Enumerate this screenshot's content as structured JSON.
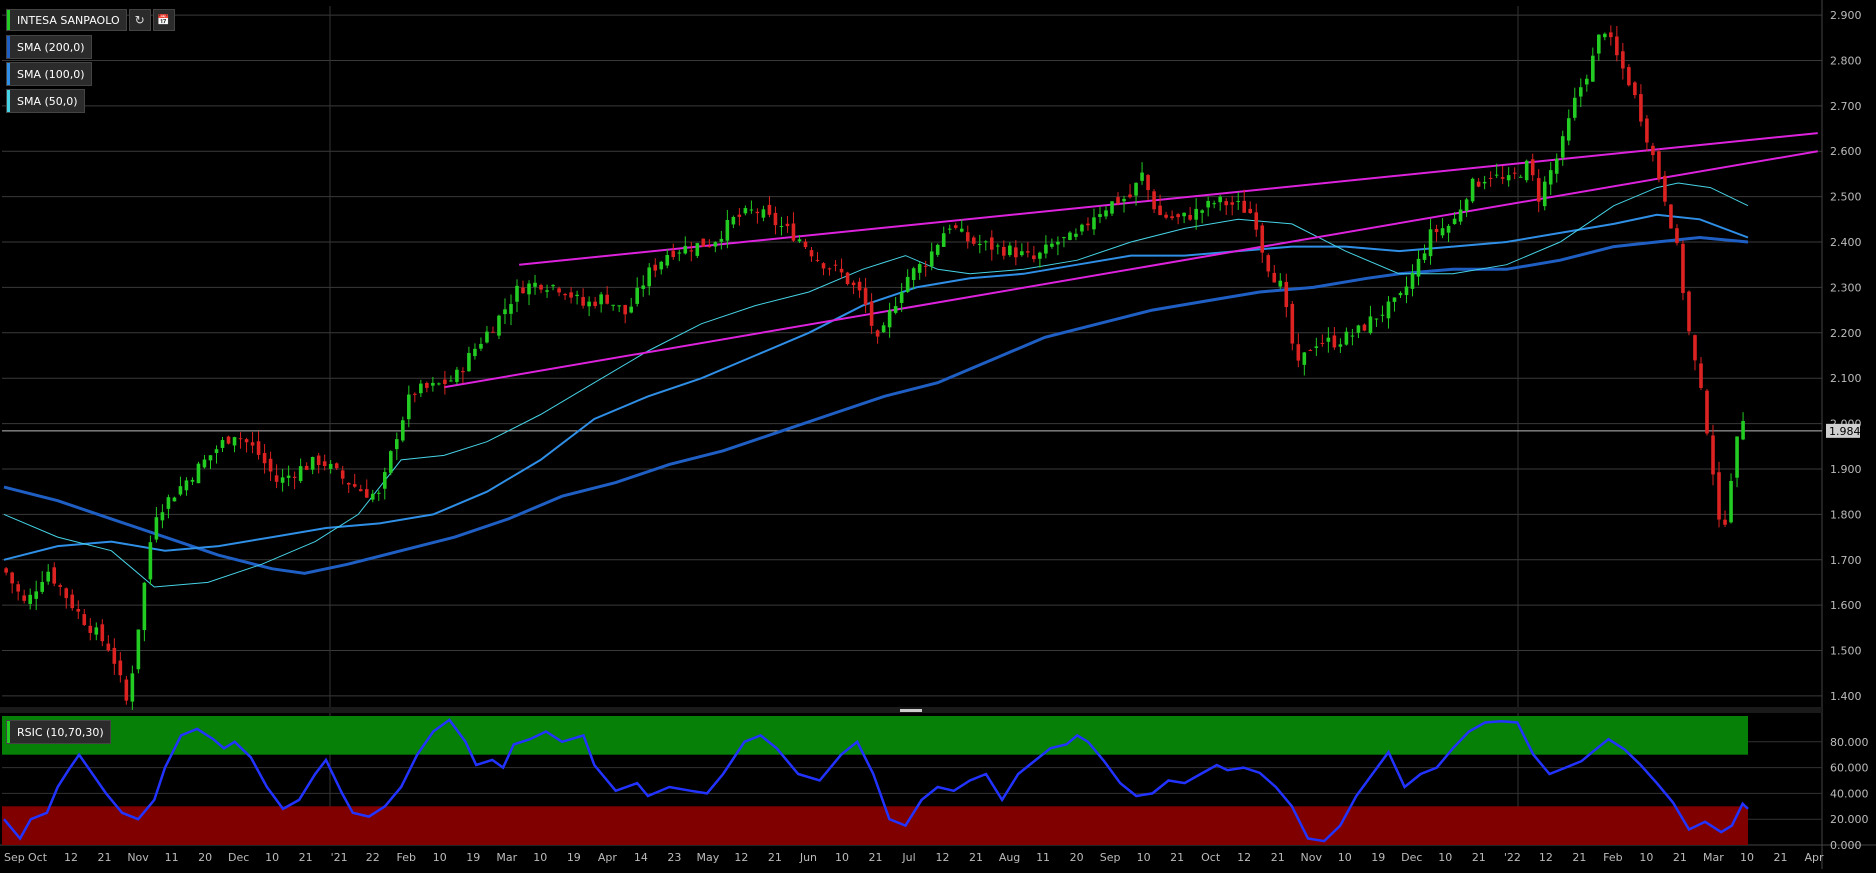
{
  "instrument": {
    "name": "INTESA SANPAOLO",
    "last_price_label": "1.984",
    "refresh_icon": "refresh-icon",
    "calendar_icon": "calendar-icon"
  },
  "indicators": [
    {
      "label": "SMA (200,0)",
      "color": "#1f5fc4"
    },
    {
      "label": "SMA (100,0)",
      "color": "#2f8fe6"
    },
    {
      "label": "SMA (50,0)",
      "color": "#46d3e6"
    }
  ],
  "rsi_panel": {
    "label": "RSIC (10,70,30)",
    "color": "#2233ff"
  },
  "colors": {
    "up": "#22cc22",
    "down": "#dd2222",
    "trendline": "#dd22dd",
    "overbought_zone": "#078007",
    "oversold_zone": "#800000"
  },
  "chart_data": [
    {
      "type": "candlestick",
      "y_ticks": [
        "2.900",
        "2.800",
        "2.700",
        "2.600",
        "2.500",
        "2.400",
        "2.300",
        "2.200",
        "2.100",
        "2.000",
        "1.900",
        "1.800",
        "1.700",
        "1.600",
        "1.500",
        "1.400"
      ],
      "ylim": [
        1.38,
        2.92
      ],
      "x_ticks": [
        "Sep",
        "Oct",
        "12",
        "21",
        "Nov",
        "11",
        "20",
        "Dec",
        "10",
        "21",
        "'21",
        "22",
        "Feb",
        "10",
        "19",
        "Mar",
        "10",
        "19",
        "Apr",
        "14",
        "23",
        "May",
        "12",
        "21",
        "Jun",
        "10",
        "21",
        "Jul",
        "12",
        "21",
        "Aug",
        "11",
        "20",
        "Sep",
        "10",
        "21",
        "Oct",
        "12",
        "21",
        "Nov",
        "10",
        "19",
        "Dec",
        "10",
        "21",
        "'22",
        "12",
        "21",
        "Feb",
        "10",
        "21",
        "Mar",
        "10",
        "21",
        "Apr"
      ],
      "last_price": 1.984,
      "close_path": [
        [
          0,
          1.68
        ],
        [
          20,
          1.6
        ],
        [
          40,
          1.68
        ],
        [
          70,
          1.58
        ],
        [
          100,
          1.5
        ],
        [
          115,
          1.38
        ],
        [
          125,
          1.55
        ],
        [
          140,
          1.8
        ],
        [
          160,
          1.85
        ],
        [
          180,
          1.9
        ],
        [
          200,
          1.95
        ],
        [
          215,
          1.98
        ],
        [
          235,
          1.94
        ],
        [
          255,
          1.87
        ],
        [
          275,
          1.9
        ],
        [
          295,
          1.92
        ],
        [
          315,
          1.88
        ],
        [
          335,
          1.85
        ],
        [
          350,
          1.84
        ],
        [
          365,
          1.97
        ],
        [
          380,
          2.07
        ],
        [
          400,
          2.08
        ],
        [
          420,
          2.1
        ],
        [
          440,
          2.17
        ],
        [
          460,
          2.23
        ],
        [
          480,
          2.3
        ],
        [
          500,
          2.31
        ],
        [
          520,
          2.3
        ],
        [
          540,
          2.26
        ],
        [
          560,
          2.28
        ],
        [
          580,
          2.24
        ],
        [
          600,
          2.33
        ],
        [
          620,
          2.38
        ],
        [
          640,
          2.39
        ],
        [
          660,
          2.4
        ],
        [
          680,
          2.45
        ],
        [
          700,
          2.47
        ],
        [
          720,
          2.44
        ],
        [
          740,
          2.41
        ],
        [
          760,
          2.36
        ],
        [
          780,
          2.33
        ],
        [
          800,
          2.28
        ],
        [
          815,
          2.17
        ],
        [
          825,
          2.24
        ],
        [
          840,
          2.32
        ],
        [
          860,
          2.36
        ],
        [
          880,
          2.44
        ],
        [
          900,
          2.4
        ],
        [
          920,
          2.39
        ],
        [
          940,
          2.38
        ],
        [
          960,
          2.36
        ],
        [
          980,
          2.4
        ],
        [
          1000,
          2.41
        ],
        [
          1015,
          2.46
        ],
        [
          1035,
          2.49
        ],
        [
          1050,
          2.5
        ],
        [
          1060,
          2.55
        ],
        [
          1075,
          2.46
        ],
        [
          1095,
          2.45
        ],
        [
          1115,
          2.47
        ],
        [
          1130,
          2.49
        ],
        [
          1150,
          2.48
        ],
        [
          1165,
          2.46
        ],
        [
          1175,
          2.36
        ],
        [
          1190,
          2.3
        ],
        [
          1205,
          2.12
        ],
        [
          1220,
          2.18
        ],
        [
          1240,
          2.18
        ],
        [
          1260,
          2.2
        ],
        [
          1280,
          2.24
        ],
        [
          1300,
          2.27
        ],
        [
          1315,
          2.34
        ],
        [
          1330,
          2.42
        ],
        [
          1350,
          2.44
        ],
        [
          1365,
          2.52
        ],
        [
          1385,
          2.55
        ],
        [
          1400,
          2.53
        ],
        [
          1420,
          2.57
        ],
        [
          1430,
          2.5
        ],
        [
          1450,
          2.6
        ],
        [
          1465,
          2.72
        ],
        [
          1480,
          2.8
        ],
        [
          1490,
          2.88
        ],
        [
          1500,
          2.82
        ],
        [
          1515,
          2.75
        ],
        [
          1525,
          2.68
        ],
        [
          1535,
          2.6
        ],
        [
          1550,
          2.48
        ],
        [
          1560,
          2.37
        ],
        [
          1570,
          2.2
        ],
        [
          1580,
          2.08
        ],
        [
          1590,
          1.95
        ],
        [
          1600,
          1.73
        ],
        [
          1610,
          1.9
        ],
        [
          1620,
          2.02
        ],
        [
          1625,
          1.96
        ]
      ],
      "sma50": [
        [
          0,
          1.8
        ],
        [
          50,
          1.75
        ],
        [
          100,
          1.72
        ],
        [
          140,
          1.64
        ],
        [
          190,
          1.65
        ],
        [
          240,
          1.69
        ],
        [
          290,
          1.74
        ],
        [
          330,
          1.8
        ],
        [
          370,
          1.92
        ],
        [
          410,
          1.93
        ],
        [
          450,
          1.96
        ],
        [
          500,
          2.02
        ],
        [
          550,
          2.09
        ],
        [
          600,
          2.16
        ],
        [
          650,
          2.22
        ],
        [
          700,
          2.26
        ],
        [
          750,
          2.29
        ],
        [
          800,
          2.34
        ],
        [
          840,
          2.37
        ],
        [
          870,
          2.34
        ],
        [
          900,
          2.33
        ],
        [
          950,
          2.34
        ],
        [
          1000,
          2.36
        ],
        [
          1050,
          2.4
        ],
        [
          1100,
          2.43
        ],
        [
          1150,
          2.45
        ],
        [
          1200,
          2.44
        ],
        [
          1250,
          2.38
        ],
        [
          1300,
          2.33
        ],
        [
          1350,
          2.33
        ],
        [
          1400,
          2.35
        ],
        [
          1450,
          2.4
        ],
        [
          1500,
          2.48
        ],
        [
          1540,
          2.52
        ],
        [
          1560,
          2.53
        ],
        [
          1590,
          2.52
        ],
        [
          1625,
          2.48
        ]
      ],
      "sma100": [
        [
          0,
          1.7
        ],
        [
          50,
          1.73
        ],
        [
          100,
          1.74
        ],
        [
          150,
          1.72
        ],
        [
          200,
          1.73
        ],
        [
          250,
          1.75
        ],
        [
          300,
          1.77
        ],
        [
          350,
          1.78
        ],
        [
          400,
          1.8
        ],
        [
          450,
          1.85
        ],
        [
          500,
          1.92
        ],
        [
          550,
          2.01
        ],
        [
          600,
          2.06
        ],
        [
          650,
          2.1
        ],
        [
          700,
          2.15
        ],
        [
          750,
          2.2
        ],
        [
          800,
          2.26
        ],
        [
          850,
          2.3
        ],
        [
          900,
          2.32
        ],
        [
          950,
          2.33
        ],
        [
          1000,
          2.35
        ],
        [
          1050,
          2.37
        ],
        [
          1100,
          2.37
        ],
        [
          1150,
          2.38
        ],
        [
          1200,
          2.39
        ],
        [
          1250,
          2.39
        ],
        [
          1300,
          2.38
        ],
        [
          1350,
          2.39
        ],
        [
          1400,
          2.4
        ],
        [
          1450,
          2.42
        ],
        [
          1500,
          2.44
        ],
        [
          1540,
          2.46
        ],
        [
          1580,
          2.45
        ],
        [
          1625,
          2.41
        ]
      ],
      "sma200": [
        [
          0,
          1.86
        ],
        [
          50,
          1.83
        ],
        [
          100,
          1.79
        ],
        [
          150,
          1.75
        ],
        [
          200,
          1.71
        ],
        [
          250,
          1.68
        ],
        [
          280,
          1.67
        ],
        [
          320,
          1.69
        ],
        [
          370,
          1.72
        ],
        [
          420,
          1.75
        ],
        [
          470,
          1.79
        ],
        [
          520,
          1.84
        ],
        [
          570,
          1.87
        ],
        [
          620,
          1.91
        ],
        [
          670,
          1.94
        ],
        [
          720,
          1.98
        ],
        [
          770,
          2.02
        ],
        [
          820,
          2.06
        ],
        [
          870,
          2.09
        ],
        [
          920,
          2.14
        ],
        [
          970,
          2.19
        ],
        [
          1020,
          2.22
        ],
        [
          1070,
          2.25
        ],
        [
          1120,
          2.27
        ],
        [
          1170,
          2.29
        ],
        [
          1220,
          2.3
        ],
        [
          1270,
          2.32
        ],
        [
          1300,
          2.33
        ],
        [
          1350,
          2.34
        ],
        [
          1400,
          2.34
        ],
        [
          1450,
          2.36
        ],
        [
          1500,
          2.39
        ],
        [
          1540,
          2.4
        ],
        [
          1580,
          2.41
        ],
        [
          1625,
          2.4
        ]
      ],
      "trendlines": [
        {
          "from": [
            480,
            2.35
          ],
          "to": [
            1690,
            2.64
          ]
        },
        {
          "from": [
            410,
            2.08
          ],
          "to": [
            1690,
            2.6
          ]
        }
      ]
    },
    {
      "type": "line",
      "title": "RSIC (10,70,30)",
      "y_ticks": [
        "80.000",
        "60.000",
        "40.000",
        "20.000",
        "0.000"
      ],
      "ylim": [
        0,
        100
      ],
      "zones": {
        "overbought": [
          70,
          100
        ],
        "oversold": [
          0,
          30
        ]
      },
      "values": [
        [
          0,
          20
        ],
        [
          15,
          5
        ],
        [
          25,
          20
        ],
        [
          40,
          25
        ],
        [
          50,
          45
        ],
        [
          60,
          58
        ],
        [
          70,
          70
        ],
        [
          80,
          58
        ],
        [
          95,
          40
        ],
        [
          110,
          25
        ],
        [
          125,
          20
        ],
        [
          140,
          35
        ],
        [
          150,
          60
        ],
        [
          165,
          85
        ],
        [
          180,
          90
        ],
        [
          195,
          82
        ],
        [
          205,
          75
        ],
        [
          215,
          80
        ],
        [
          230,
          68
        ],
        [
          245,
          45
        ],
        [
          260,
          28
        ],
        [
          275,
          35
        ],
        [
          290,
          55
        ],
        [
          300,
          66
        ],
        [
          315,
          40
        ],
        [
          325,
          25
        ],
        [
          340,
          22
        ],
        [
          355,
          30
        ],
        [
          370,
          45
        ],
        [
          385,
          70
        ],
        [
          400,
          88
        ],
        [
          415,
          97
        ],
        [
          430,
          80
        ],
        [
          440,
          62
        ],
        [
          455,
          66
        ],
        [
          465,
          60
        ],
        [
          475,
          78
        ],
        [
          490,
          82
        ],
        [
          505,
          88
        ],
        [
          520,
          80
        ],
        [
          540,
          85
        ],
        [
          550,
          62
        ],
        [
          570,
          42
        ],
        [
          590,
          48
        ],
        [
          600,
          38
        ],
        [
          620,
          45
        ],
        [
          640,
          42
        ],
        [
          655,
          40
        ],
        [
          670,
          55
        ],
        [
          690,
          80
        ],
        [
          705,
          85
        ],
        [
          720,
          75
        ],
        [
          740,
          55
        ],
        [
          760,
          50
        ],
        [
          780,
          70
        ],
        [
          795,
          80
        ],
        [
          810,
          55
        ],
        [
          825,
          20
        ],
        [
          840,
          15
        ],
        [
          855,
          35
        ],
        [
          870,
          45
        ],
        [
          885,
          42
        ],
        [
          900,
          50
        ],
        [
          915,
          55
        ],
        [
          930,
          35
        ],
        [
          945,
          55
        ],
        [
          960,
          65
        ],
        [
          975,
          75
        ],
        [
          990,
          78
        ],
        [
          1000,
          85
        ],
        [
          1010,
          80
        ],
        [
          1025,
          65
        ],
        [
          1040,
          48
        ],
        [
          1055,
          38
        ],
        [
          1070,
          40
        ],
        [
          1085,
          50
        ],
        [
          1100,
          48
        ],
        [
          1115,
          55
        ],
        [
          1130,
          62
        ],
        [
          1140,
          58
        ],
        [
          1155,
          60
        ],
        [
          1170,
          56
        ],
        [
          1185,
          45
        ],
        [
          1200,
          30
        ],
        [
          1215,
          5
        ],
        [
          1230,
          3
        ],
        [
          1245,
          15
        ],
        [
          1260,
          38
        ],
        [
          1275,
          55
        ],
        [
          1290,
          72
        ],
        [
          1305,
          45
        ],
        [
          1320,
          55
        ],
        [
          1335,
          60
        ],
        [
          1350,
          75
        ],
        [
          1365,
          88
        ],
        [
          1380,
          95
        ],
        [
          1395,
          96
        ],
        [
          1410,
          95
        ],
        [
          1425,
          70
        ],
        [
          1440,
          55
        ],
        [
          1455,
          60
        ],
        [
          1470,
          65
        ],
        [
          1480,
          72
        ],
        [
          1495,
          82
        ],
        [
          1510,
          74
        ],
        [
          1525,
          62
        ],
        [
          1540,
          48
        ],
        [
          1555,
          33
        ],
        [
          1570,
          12
        ],
        [
          1585,
          18
        ],
        [
          1600,
          10
        ],
        [
          1610,
          15
        ],
        [
          1620,
          32
        ],
        [
          1625,
          28
        ]
      ]
    }
  ]
}
